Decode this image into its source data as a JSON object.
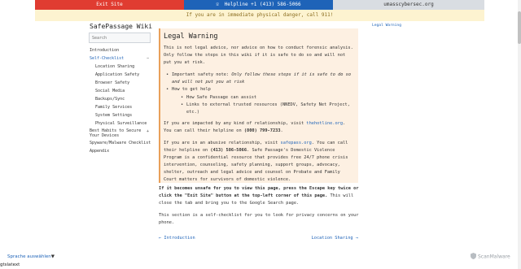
{
  "topbar": {
    "exit_label": "Exit Site",
    "helpline_icon": "phone-icon",
    "helpline_label": "Helpline +1 (413) 586-5066",
    "cyber_label": "umasscybersec.org"
  },
  "banner": {
    "danger_text": "If you are in immediate physical danger, call 911!"
  },
  "sidebar": {
    "title": "SafePassage Wiki",
    "search_placeholder": "Search",
    "items": [
      {
        "label": "Introduction"
      },
      {
        "label": "Self-Checklist",
        "chevron": "−"
      },
      {
        "label": "Location Sharing"
      },
      {
        "label": "Application Safety"
      },
      {
        "label": "Browser Safety"
      },
      {
        "label": "Social Media"
      },
      {
        "label": "Backups/Sync"
      },
      {
        "label": "Family Services"
      },
      {
        "label": "System Settings"
      },
      {
        "label": "Physical Surveillance"
      },
      {
        "label_line1": "Best Habits to Secure",
        "label_line2": "Your Devices",
        "chevron": "+"
      },
      {
        "label": "Spyware/Malware Checklist"
      },
      {
        "label": "Appendix"
      }
    ]
  },
  "warning": {
    "heading": "Legal Warning",
    "para1": "This is not legal advice, nor advice on how to conduct forensic analysis. Only follow the steps in this wiki if it is safe to do so and will not put you at risk.",
    "bullet1_prefix": "Important safety note: ",
    "bullet1_em": "Only follow these steps if it is safe to do so and will not put you at risk",
    "bullet2": "How to get help",
    "sub1": "How Safe Passage can assist",
    "sub2": "Links to external trusted resources (NNEDV, Safety Net Project, etc.)",
    "para2_a": "If you are impacted by any kind of relationship, visit ",
    "para2_link": "thehotline.org",
    "para2_b": ". You can call their helpline on ",
    "para2_phone": "(800) 799-7233",
    "para2_c": ".",
    "para3_a": "If you are in an abusive relationship, visit ",
    "para3_link": "safepass.org",
    "para3_b": ". You can call their helpline on ",
    "para3_phone": "(413) 586-5066",
    "para3_c": ". Safe Passage's Domestic Violence Program is a confidential resource that provides free 24/7 phone crisis intervention, counseling, safety planning, support groups, advocacy, shelter, outreach and legal advice and counsel on Probate and Family Court matters for survivors of domestic violence."
  },
  "main": {
    "escape_bold": "If it becomes unsafe for you to view this page, press the Escape key twice or click the \"Exit Site\" button at the top-left corner of this page.",
    "escape_rest": " This will close the tab and bring you to the Google Search page.",
    "intro_text": "This section is a self-checklist for you to look for privacy concerns on your phone.",
    "prev_label": "← Introduction",
    "next_label": "Location Sharing →"
  },
  "toc": {
    "label": "Legal Warning"
  },
  "footer": {
    "brand": "ScanMalware",
    "brand_icon": "shield-logo-icon",
    "language_label": "Sprache auswählen",
    "language_caret": "▼",
    "gt_label": "gtslatext"
  },
  "colors": {
    "exit_red": "#e03c31",
    "helpline_blue": "#1e63b8",
    "danger_bg": "#fdf3d0",
    "warning_bg": "#fdf0e2",
    "link": "#1e63b8"
  }
}
